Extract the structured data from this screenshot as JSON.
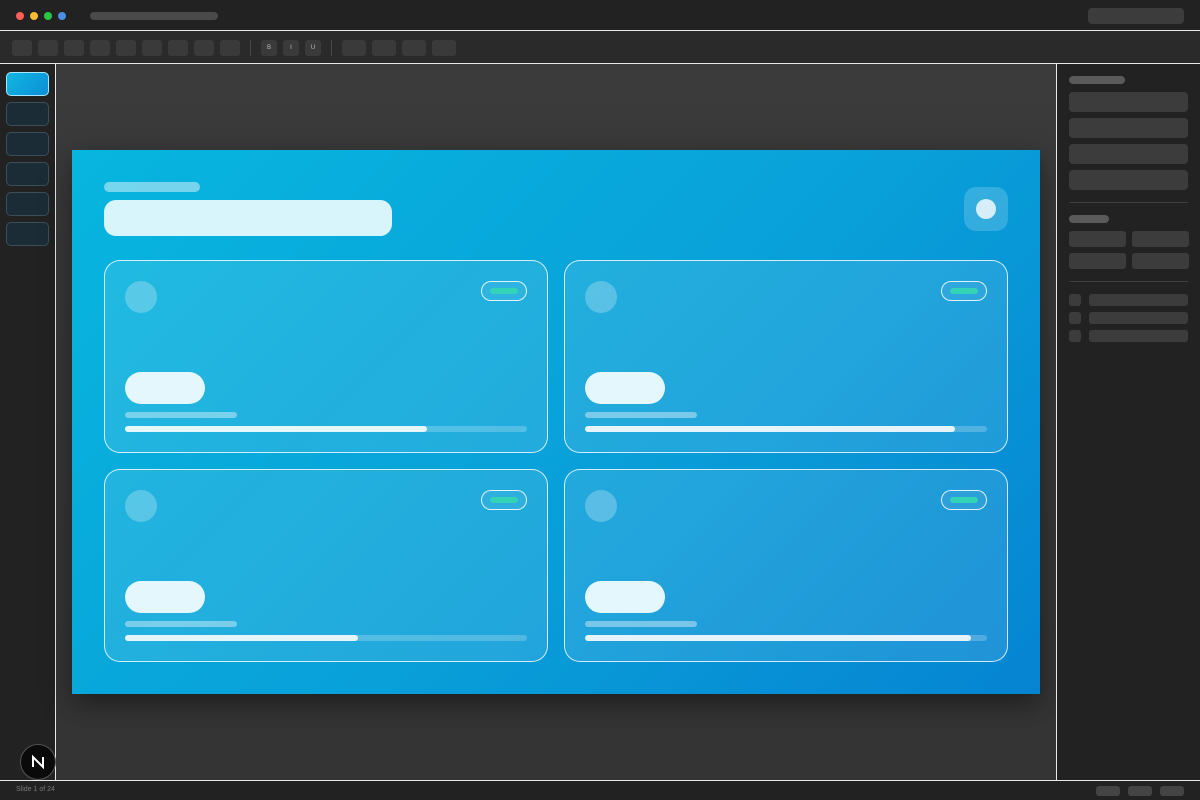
{
  "app": {
    "traffic_colors": [
      "#ff5f57",
      "#febc2e",
      "#28c840",
      "#4a90e2"
    ]
  },
  "slide": {
    "tag_color": "#32d3b7",
    "cards": [
      {
        "progress": 0.75
      },
      {
        "progress": 0.92
      },
      {
        "progress": 0.58
      },
      {
        "progress": 0.96
      }
    ]
  },
  "statusbar": {
    "slide_counter": "Slide 1 of 24"
  },
  "icons": {
    "logo": "n-logo-icon"
  }
}
